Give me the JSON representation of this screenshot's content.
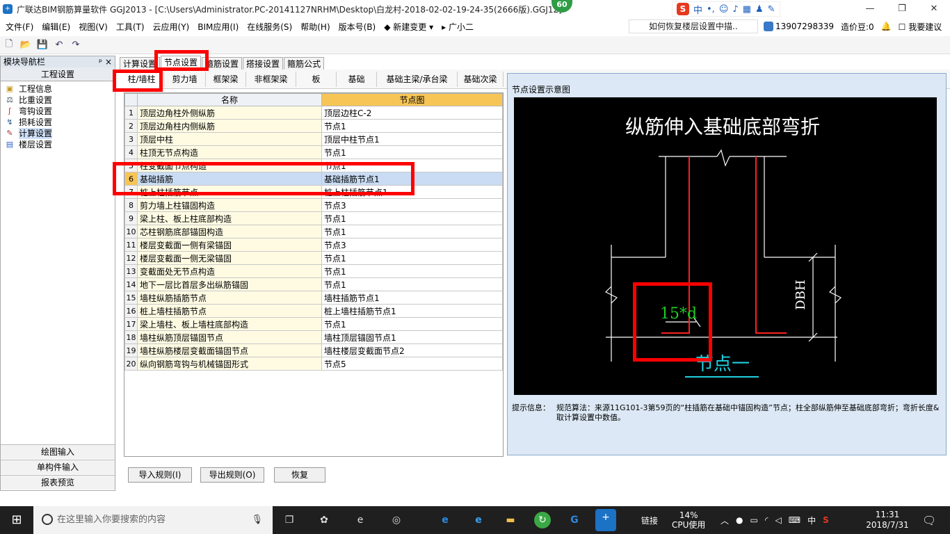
{
  "titlebar": {
    "title": "广联达BIM钢筋算量软件 GGJ2013 - [C:\\Users\\Administrator.PC-20141127NRHM\\Desktop\\白龙村-2018-02-02-19-24-35(2666版).GGJ12]",
    "badge": "60",
    "ime_labels": [
      "中",
      "•,"
    ]
  },
  "menu": {
    "items": [
      "文件(F)",
      "编辑(E)",
      "视图(V)",
      "工具(T)",
      "云应用(Y)",
      "BIM应用(I)",
      "在线服务(S)",
      "帮助(H)",
      "版本号(B)",
      "新建变更",
      "广小二"
    ],
    "hint": "如何恢复楼层设置中描..",
    "phone": "13907298339",
    "credits": "造价豆:0",
    "suggest": "我要建议"
  },
  "nav": {
    "header": "模块导航栏",
    "pin": "ᵖ ×",
    "section": "工程设置",
    "items": [
      "工程信息",
      "比重设置",
      "弯钩设置",
      "损耗设置",
      "计算设置",
      "楼层设置"
    ],
    "bottom": [
      "绘图输入",
      "单构件输入",
      "报表预览"
    ]
  },
  "tabs": [
    "计算设置",
    "节点设置",
    "箍筋设置",
    "搭接设置",
    "箍筋公式"
  ],
  "subtabs": [
    "柱/墙柱",
    "剪力墙",
    "框架梁",
    "非框架梁",
    "板",
    "基础",
    "基础主梁/承台梁",
    "基础次梁"
  ],
  "table": {
    "col_name": "名称",
    "col_node": "节点图",
    "selected": 6,
    "rows": [
      {
        "n": "1",
        "name": "顶层边角柱外侧纵筋",
        "node": "顶层边柱C-2"
      },
      {
        "n": "2",
        "name": "顶层边角柱内侧纵筋",
        "node": "节点1"
      },
      {
        "n": "3",
        "name": "顶层中柱",
        "node": "顶层中柱节点1"
      },
      {
        "n": "4",
        "name": "柱顶无节点构造",
        "node": "节点1"
      },
      {
        "n": "5",
        "name": "柱变截面节点构造",
        "node": "节点1"
      },
      {
        "n": "6",
        "name": "基础插筋",
        "node": "基础插筋节点1"
      },
      {
        "n": "7",
        "name": "桩上柱插筋节点",
        "node": "桩上柱插筋节点1"
      },
      {
        "n": "8",
        "name": "剪力墙上柱锚固构造",
        "node": "节点3"
      },
      {
        "n": "9",
        "name": "梁上柱、板上柱底部构造",
        "node": "节点1"
      },
      {
        "n": "10",
        "name": "芯柱钢筋底部锚固构造",
        "node": "节点1"
      },
      {
        "n": "11",
        "name": "楼层变截面一侧有梁锚固",
        "node": "节点3"
      },
      {
        "n": "12",
        "name": "楼层变截面一侧无梁锚固",
        "node": "节点1"
      },
      {
        "n": "13",
        "name": "变截面处无节点构造",
        "node": "节点1"
      },
      {
        "n": "14",
        "name": "地下一层比首层多出纵筋锚固",
        "node": "节点1"
      },
      {
        "n": "15",
        "name": "墙柱纵筋插筋节点",
        "node": "墙柱插筋节点1"
      },
      {
        "n": "16",
        "name": "桩上墙柱插筋节点",
        "node": "桩上墙柱插筋节点1"
      },
      {
        "n": "17",
        "name": "梁上墙柱、板上墙柱底部构造",
        "node": "节点1"
      },
      {
        "n": "18",
        "name": "墙柱纵筋顶层锚固节点",
        "node": "墙柱顶层锚固节点1"
      },
      {
        "n": "19",
        "name": "墙柱纵筋楼层变截面锚固节点",
        "node": "墙柱楼层变截面节点2"
      },
      {
        "n": "20",
        "name": "纵向钢筋弯钩与机械锚固形式",
        "node": "节点5"
      }
    ]
  },
  "diagram": {
    "panel_title": "节点设置示意图",
    "title": "纵筋伸入基础底部弯折",
    "dim_label": "15*d",
    "dbh_label": "DBH",
    "node_label": "节点一",
    "hint_key": "提示信息：",
    "hint_text": "规范算法：来源11G101-3第59页的“柱插筋在基础中锚固构造”节点；柱全部纵筋伸至基础底部弯折；弯折长度&取计算设置中数值。",
    "colors": {
      "bg": "#000000",
      "lines": "#ffffff",
      "rebar": "#ff2020",
      "dim": "#22cc22",
      "node": "#20d0e0"
    }
  },
  "buttons": {
    "import": "导入规则(I)",
    "export": "导出规则(O)",
    "restore": "恢复"
  },
  "taskbar": {
    "search": "在这里输入你要搜索的内容",
    "link": "链接",
    "cpu_pct": "14%",
    "cpu_label": "CPU使用",
    "lang": "中",
    "time": "11:31",
    "date": "2018/7/31"
  }
}
